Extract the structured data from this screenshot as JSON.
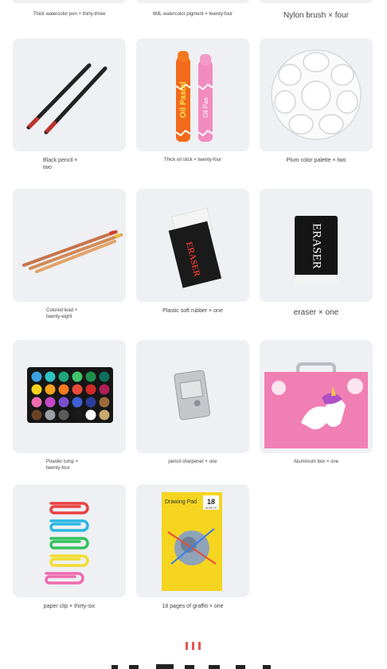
{
  "top_row": [
    {
      "label": "Thick watercolor pen × thirty-three"
    },
    {
      "label": "6ML watercolor pigment × twenty-four"
    },
    {
      "label": "Nylon brush × four"
    }
  ],
  "items": [
    {
      "label": "Black pencil ×\ntwo"
    },
    {
      "label": "Thick oil stick × twenty-four",
      "print": {
        "brand": "Oil Pastel",
        "brand2": "Oil Pas"
      }
    },
    {
      "label": "Plum color palette × two"
    },
    {
      "label": "Colored lead ×\ntwenty-eight"
    },
    {
      "label": "Plastic soft rubber × one",
      "print": {
        "brand": "ERASER"
      }
    },
    {
      "label": "eraser × one",
      "print": {
        "brand": "ERASER"
      }
    },
    {
      "label": "Powder lump ×\ntwenty-four"
    },
    {
      "label": "pencil sharpener × one"
    },
    {
      "label": "Aluminium box × one"
    },
    {
      "label": "paper clip × thirty-six"
    },
    {
      "label": "18 pages of graffiti × one",
      "print": {
        "title": "Drawing Pad",
        "count": "18",
        "unit": "SHEETS"
      }
    }
  ],
  "colors": {
    "card_bg": "#eef0f3",
    "accent_red": "#e2574c",
    "palette_colors": [
      "#3aa0e0",
      "#2ec4c4",
      "#1ea67a",
      "#42c46a",
      "#1f8f4d",
      "#0f6e5e",
      "#f5d31c",
      "#f7a21c",
      "#f27a1e",
      "#e94b3c",
      "#d12a2a",
      "#b02058",
      "#f06ab0",
      "#c249c9",
      "#7a4fd0",
      "#3f5fd6",
      "#2c3d9a",
      "#9c6a3a",
      "#6b4226",
      "#9aa0a6",
      "#5c5c5c",
      "#1a1a1a",
      "#ffffff",
      "#c7a96b"
    ]
  }
}
